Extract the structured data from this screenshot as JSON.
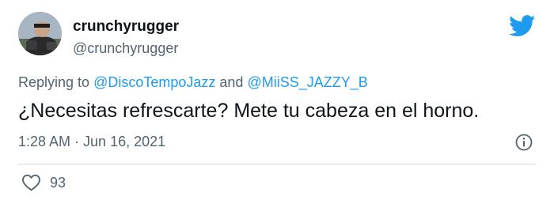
{
  "tweet": {
    "author": {
      "display_name": "crunchyrugger",
      "handle": "@crunchyrugger",
      "avatar_icon": "user-avatar"
    },
    "brand_icon": "twitter-bird-icon",
    "reply": {
      "prefix": "Replying to ",
      "mention_1": "@DiscoTempoJazz",
      "joiner": " and ",
      "mention_2": "@MiiSS_JAZZY_B"
    },
    "text": "¿Necesitas refrescarte? Mete tu cabeza en el horno.",
    "time": "1:28 AM",
    "separator": " · ",
    "date": "Jun 16, 2021",
    "info_icon": "info-icon",
    "likes": {
      "icon": "heart-icon",
      "count": "93"
    }
  },
  "colors": {
    "primary_text": "#0f1419",
    "secondary_text": "#536471",
    "accent": "#1d9bf0",
    "divider": "#cfd9de"
  }
}
